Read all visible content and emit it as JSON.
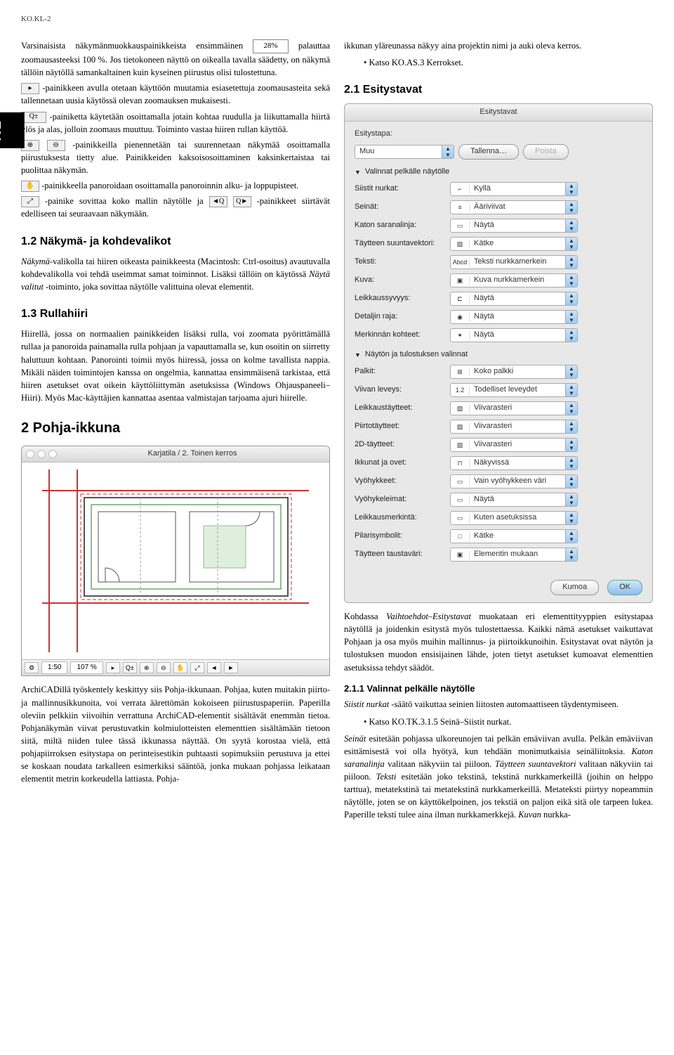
{
  "page_code": "KO.KL-2",
  "kl_tab": "KL",
  "col_left": {
    "para1a": "Varsinaisista näkymänmuokkauspainikkeista ensimmäinen ",
    "zoom_value": "28%",
    "para1b": " palauttaa zoomausasteeksi 100 %. Jos tietokoneen näyttö on oikealla tavalla säädetty, on näkymä tällöin näytöllä samankaltainen kuin kyseinen piirustus olisi tulostettuna.",
    "para2": "-painikkeen avulla otetaan käyttöön muutamia esiasetettuja zoomausasteita sekä tallennetaan uusia käytössä olevan zoomauksen mukaisesti.",
    "para3": "-painiketta käytetään osoittamalla jotain kohtaa ruudulla ja liikuttamalla hiirtä ylös ja alas, jolloin zoomaus muuttuu. Toiminto vastaa hiiren rullan käyttöä.",
    "para4": "-painikkeilla pienennetään tai suurennetaan näkymää osoittamalla piirustuksesta tietty alue. Painikkeiden kaksoisosoittaminen kaksinkertaistaa tai puolittaa näkymän.",
    "para5": "-painikkeella panoroidaan osoittamalla panoroinnin alku- ja loppupisteet.",
    "para6a": "-painike sovittaa koko mallin näytölle ja ",
    "para6b": "-painikkeet siirtävät edelliseen tai seuraavaan näkymään.",
    "h_12": "1.2 Näkymä- ja kohdevalikot",
    "para_12a_em": "Näkymä",
    "para_12a": "-valikolla tai hiiren oikeasta painikkeesta (Macintosh: Ctrl-osoitus) avautuvalla kohdevalikolla voi tehdä useimmat samat toiminnot. Lisäksi tällöin on käytössä ",
    "para_12a_em2": "Näytä valitut",
    "para_12a_end": " -toiminto, joka sovittaa näytölle valittuina olevat elementit.",
    "h_13": "1.3 Rullahiiri",
    "para_13": "Hiirellä, jossa on normaalien painikkeiden lisäksi rulla, voi zoomata pyörittämällä rullaa ja panoroida painamalla rulla pohjaan ja vapauttamalla se, kun osoitin on siirretty haluttuun kohtaan. Panorointi toimii myös hiiressä, jossa on kolme tavallista nappia. Mikäli näiden toimintojen kanssa on ongelmia, kannattaa ensimmäisenä tarkistaa, että hiiren asetukset ovat oikein käyttöliittymän asetuksissa (Windows Ohjauspaneeli–Hiiri). Myös Mac-käyttäjien kannattaa asentaa valmistajan tarjoama ajuri hiirelle.",
    "h_2": "2 Pohja-ikkuna",
    "plan_title": "Karjatila / 2. Toinen kerros",
    "status_scale": "1:50",
    "status_zoom": "107 %",
    "para_plan": "ArchiCADillä työskentely keskittyy siis Pohja-ikkunaan. Pohjaa, kuten muitakin piirto- ja mallinnusikkunoita, voi verrata äärettömän kokoiseen piirustuspaperiin. Paperilla oleviin pelkkiin viivoihin verrattuna ArchiCAD-elementit sisältävät enemmän tietoa. Pohjanäkymän viivat perustuvatkin kolmiulotteisten elementtien sisältämään tietoon siitä, miltä niiden tulee tässä ikkunassa näyttää. On syytä korostaa vielä, että pohjapiirroksen esitystapa on perinteisestikin puhtaasti sopimuksiin perustuva ja ettei se koskaan noudata tarkalleen esimerkiksi sääntöä, jonka mukaan pohjassa leikataan elementit metrin korkeudella lattiasta. Pohja-"
  },
  "col_right": {
    "para_top": "ikkunan yläreunassa näkyy aina projektin nimi ja auki oleva kerros.",
    "bullet_top": "• Katso KO.AS.3 Kerrokset.",
    "h_21": "2.1 Esitystavat",
    "dialog": {
      "title": "Esitystavat",
      "label_esitystapa": "Esitystapa:",
      "sel_muu": "Muu",
      "btn_tallenna": "Tallenna…",
      "btn_poista": "Poista",
      "disc1": "Valinnat pelkälle näytölle",
      "rows1": [
        {
          "label": "Siistit nurkat:",
          "icon": "⌐",
          "value": "Kyllä"
        },
        {
          "label": "Seinät:",
          "icon": "≡",
          "value": "Ääriviivat"
        },
        {
          "label": "Katon saranalinja:",
          "icon": "▭",
          "value": "Näytä"
        },
        {
          "label": "Täytteen suuntavektori:",
          "icon": "▨",
          "value": "Kätke"
        },
        {
          "label": "Teksti:",
          "icon": "Abcd",
          "value": "Teksti nurkkamerkein"
        },
        {
          "label": "Kuva:",
          "icon": "▣",
          "value": "Kuva nurkkamerkein"
        },
        {
          "label": "Leikkaussyvyys:",
          "icon": "⊏",
          "value": "Näytä"
        },
        {
          "label": "Detaljin raja:",
          "icon": "◉",
          "value": "Näytä"
        },
        {
          "label": "Merkinnän kohteet:",
          "icon": "✦",
          "value": "Näytä"
        }
      ],
      "disc2": "Näytön ja tulostuksen valinnat",
      "rows2": [
        {
          "label": "Palkit:",
          "icon": "⊞",
          "value": "Koko palkki"
        },
        {
          "label": "Viivan leveys:",
          "icon": "1.2",
          "value": "Todelliset leveydet"
        },
        {
          "label": "Leikkaustäytteet:",
          "icon": "▨",
          "value": "Viivarasteri"
        },
        {
          "label": "Piirtotäytteet:",
          "icon": "▨",
          "value": "Viivarasteri"
        },
        {
          "label": "2D-täytteet:",
          "icon": "▨",
          "value": "Viivarasteri"
        },
        {
          "label": "Ikkunat ja ovet:",
          "icon": "⊓",
          "value": "Näkyvissä"
        },
        {
          "label": "Vyöhykkeet:",
          "icon": "▭",
          "value": "Vain vyöhykkeen väri"
        },
        {
          "label": "Vyöhykeleimat:",
          "icon": "▭",
          "value": "Näytä"
        },
        {
          "label": "Leikkausmerkintä:",
          "icon": "▭",
          "value": "Kuten asetuksissa"
        },
        {
          "label": "Pilarisymbolit:",
          "icon": "□",
          "value": "Kätke"
        },
        {
          "label": "Täytteen taustaväri:",
          "icon": "▣",
          "value": "Elementin mukaan"
        }
      ],
      "btn_kumoa": "Kumoa",
      "btn_ok": "OK"
    },
    "para_after1": "Kohdassa ",
    "para_after1_em": "Vaihtoehdot–Esitystavat",
    "para_after1_end": " muokataan eri elementtityyppien esitystapaa näytöllä ja joidenkin esitystä myös tulostettaessa. Kaikki nämä asetukset vaikuttavat Pohjaan ja osa myös muihin mallinnus- ja piirtoikkunoihin. Esitystavat ovat näytön ja tulostuksen muodon ensisijainen lähde, joten tietyt asetukset kumoavat elementtien asetuksissa tehdyt säädöt.",
    "h_211": "2.1.1 Valinnat pelkälle näytölle",
    "para_211_em": "Siistit nurkat",
    "para_211": " -säätö vaikuttaa seinien liitosten automaattiseen täydentymiseen.",
    "bullet_211": "• Katso KO.TK.3.1.5 Seinä–Siistit nurkat.",
    "para_last_em1": "Seinät",
    "para_last_1": " esitetään pohjassa ulkoreunojen tai pelkän emäviivan avulla. Pelkän emäviivan esittämisestä voi olla hyötyä, kun tehdään monimutkaisia seinäliitoksia. ",
    "para_last_em2": "Katon saranalinja",
    "para_last_2": " valitaan näkyviin tai piiloon. ",
    "para_last_em3": "Täytteen suuntavektori",
    "para_last_3": " valitaan näkyviin tai piiloon. ",
    "para_last_em4": "Teksti",
    "para_last_4": " esitetään joko tekstinä, tekstinä nurkkamerkeillä (joihin on helppo tarttua), metatekstinä tai metatekstinä nurkkamerkeillä. Metateksti piirtyy nopeammin näytölle, joten se on käyttökelpoinen, jos tekstiä on paljon eikä sitä ole tarpeen lukea. Paperille teksti tulee aina ilman nurkkamerkkejä. ",
    "para_last_em5": "Kuvan",
    "para_last_5": " nurkka-"
  }
}
